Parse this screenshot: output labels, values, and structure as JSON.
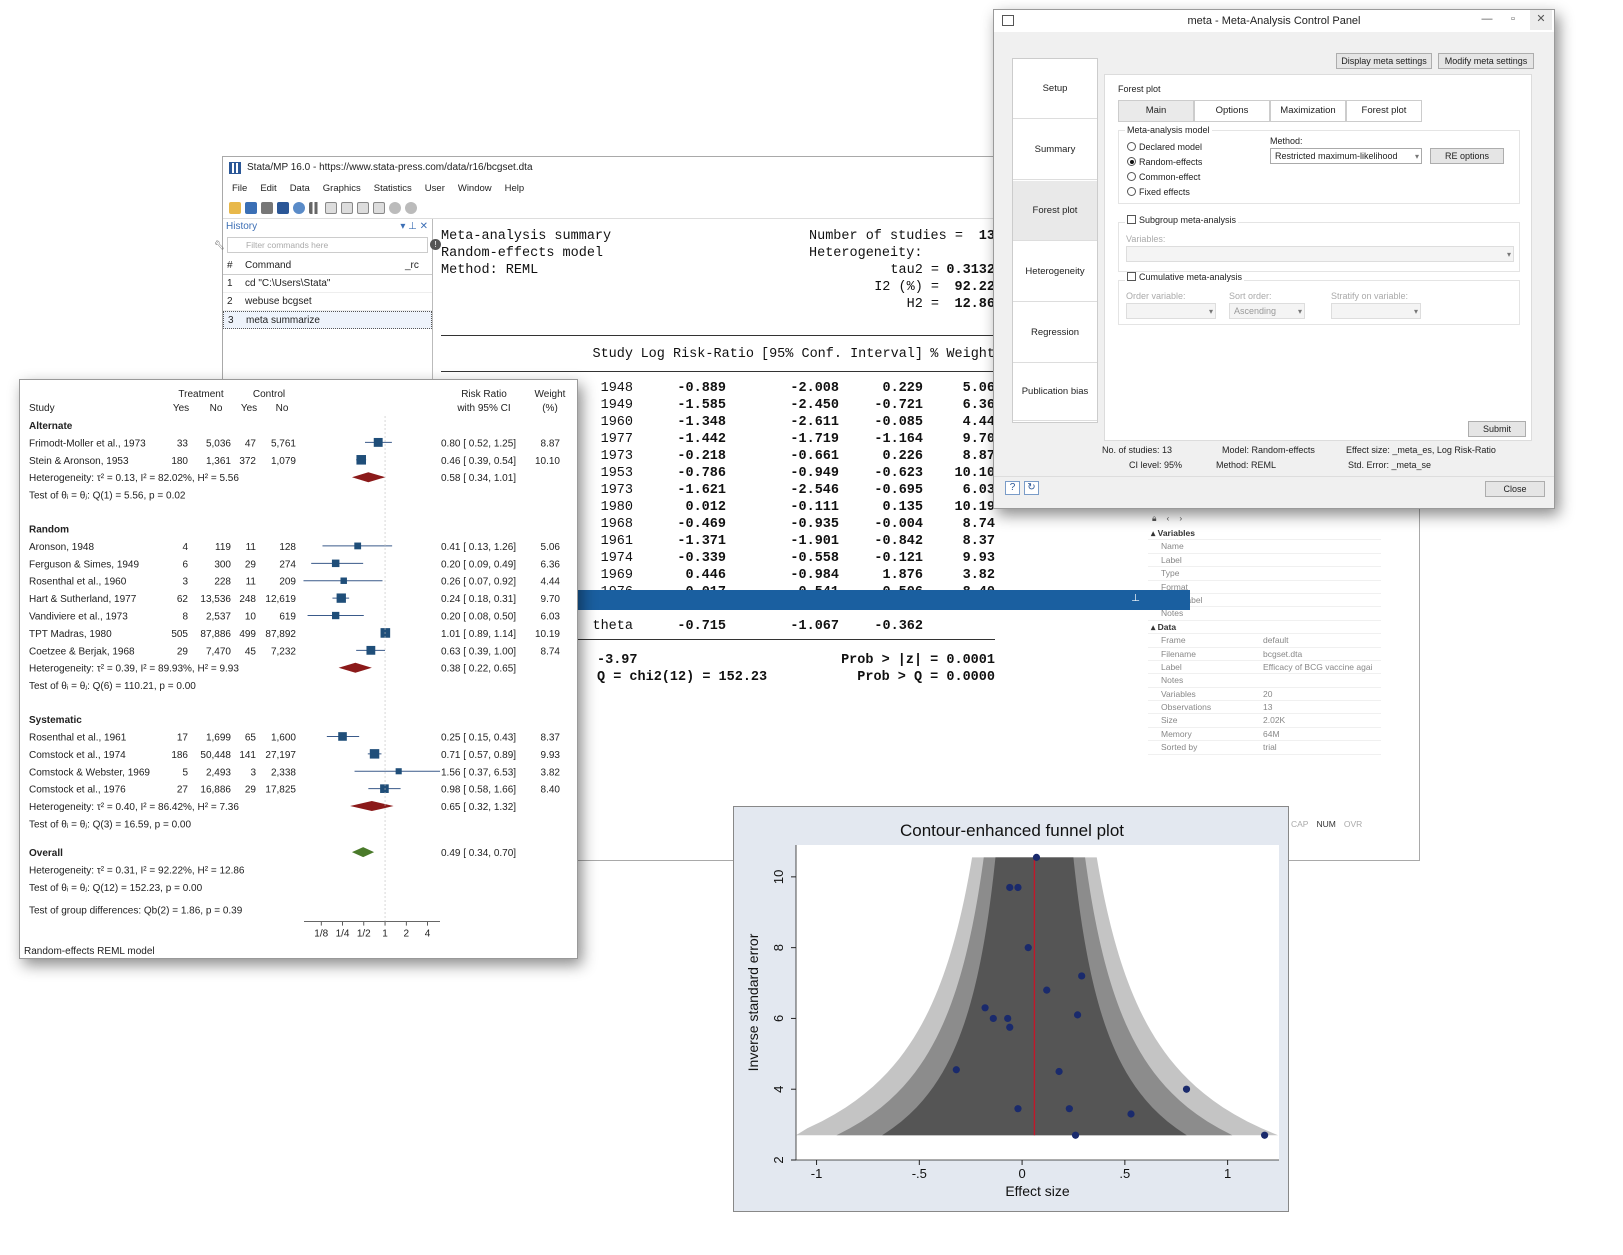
{
  "stata": {
    "title": "Stata/MP 16.0 - https://www.stata-press.com/data/r16/bcgset.dta",
    "menu": [
      "File",
      "Edit",
      "Data",
      "Graphics",
      "Statistics",
      "User",
      "Window",
      "Help"
    ],
    "history": {
      "title": "History",
      "filter_placeholder": "Filter commands here",
      "col_num": "#",
      "col_command": "Command",
      "col_rc": "_rc",
      "rows": [
        {
          "n": "1",
          "cmd": "cd \"C:\\Users\\Stata\""
        },
        {
          "n": "2",
          "cmd": "webuse bcgset"
        },
        {
          "n": "3",
          "cmd": "meta summarize"
        }
      ]
    },
    "results": {
      "l1": "Meta-analysis summary",
      "l2": "Random-effects model",
      "l3": "Method: REML",
      "n_label": "Number of studies =",
      "n_value": "13",
      "het_label": "Heterogeneity:",
      "tau2_label": "tau2 =",
      "tau2": "0.3132",
      "i2_label": "I2 (%) =",
      "i2": "92.22",
      "h2_label": "H2 =",
      "h2": "12.86",
      "headers": [
        "Study",
        "Log Risk-Ratio",
        "[95% Conf. Interval]",
        "% Weight"
      ],
      "rows": [
        {
          "year": "1948",
          "lrr": "-0.889",
          "lo": "-2.008",
          "hi": "0.229",
          "w": "5.06"
        },
        {
          "year": "1949",
          "lrr": "-1.585",
          "lo": "-2.450",
          "hi": "-0.721",
          "w": "6.36"
        },
        {
          "year": "1960",
          "lrr": "-1.348",
          "lo": "-2.611",
          "hi": "-0.085",
          "w": "4.44"
        },
        {
          "year": "1977",
          "lrr": "-1.442",
          "lo": "-1.719",
          "hi": "-1.164",
          "w": "9.70"
        },
        {
          "year": "1973",
          "lrr": "-0.218",
          "lo": "-0.661",
          "hi": "0.226",
          "w": "8.87"
        },
        {
          "year": "1953",
          "lrr": "-0.786",
          "lo": "-0.949",
          "hi": "-0.623",
          "w": "10.10"
        },
        {
          "year": "1973",
          "lrr": "-1.621",
          "lo": "-2.546",
          "hi": "-0.695",
          "w": "6.03"
        },
        {
          "year": "1980",
          "lrr": "0.012",
          "lo": "-0.111",
          "hi": "0.135",
          "w": "10.19"
        },
        {
          "year": "1968",
          "lrr": "-0.469",
          "lo": "-0.935",
          "hi": "-0.004",
          "w": "8.74"
        },
        {
          "year": "1961",
          "lrr": "-1.371",
          "lo": "-1.901",
          "hi": "-0.842",
          "w": "8.37"
        },
        {
          "year": "1974",
          "lrr": "-0.339",
          "lo": "-0.558",
          "hi": "-0.121",
          "w": "9.93"
        },
        {
          "year": "1969",
          "lrr": "0.446",
          "lo": "-0.984",
          "hi": "1.876",
          "w": "3.82"
        },
        {
          "year": "1976",
          "lrr": "-0.017",
          "lo": "-0.541",
          "hi": "0.506",
          "w": "8.40"
        }
      ],
      "theta_label": "theta",
      "theta": "-0.715",
      "theta_lo": "-1.067",
      "theta_hi": "-0.362",
      "z_text": "-3.97",
      "q_text": "Q = chi2(12) = 152.23",
      "p_z": "Prob > |z| = 0.0001",
      "p_q": "Prob > Q = 0.0000"
    },
    "properties": {
      "variables_section": "Variables",
      "var_keys": [
        "Name",
        "Label",
        "Type",
        "Format",
        "Value label",
        "Notes"
      ],
      "data_section": "Data",
      "data_rows": [
        {
          "k": "Frame",
          "v": "default"
        },
        {
          "k": "Filename",
          "v": "bcgset.dta"
        },
        {
          "k": "Label",
          "v": "Efficacy of BCG vaccine agai"
        },
        {
          "k": "Notes",
          "v": ""
        },
        {
          "k": "Variables",
          "v": "20"
        },
        {
          "k": "Observations",
          "v": "13"
        },
        {
          "k": "Size",
          "v": "2.02K"
        },
        {
          "k": "Memory",
          "v": "64M"
        },
        {
          "k": "Sorted by",
          "v": "trial"
        }
      ]
    },
    "status": [
      "CAP",
      "NUM",
      "OVR"
    ]
  },
  "forest": {
    "h_study": "Study",
    "h_treatment": "Treatment",
    "h_control": "Control",
    "h_yes": "Yes",
    "h_no": "No",
    "h_rr": "Risk Ratio",
    "h_ci": "with 95% CI",
    "h_weight": "Weight",
    "h_pct": "(%)",
    "groups": [
      {
        "name": "Alternate",
        "studies": [
          {
            "s": "Frimodt-Moller et al., 1973",
            "ty": "33",
            "tn": "5,036",
            "cy": "47",
            "cn": "5,761",
            "ci": "0.80 [  0.52,  1.25]",
            "w": "8.87",
            "rr": 0.8,
            "lo": 0.52,
            "hi": 1.25,
            "wt": 8.87
          },
          {
            "s": "Stein & Aronson, 1953",
            "ty": "180",
            "tn": "1,361",
            "cy": "372",
            "cn": "1,079",
            "ci": "0.46 [  0.39,  0.54]",
            "w": "10.10",
            "rr": 0.46,
            "lo": 0.39,
            "hi": 0.54,
            "wt": 10.1
          }
        ],
        "het": "Heterogeneity: τ² = 0.13, I² = 82.02%, H² = 5.56",
        "pooled": "0.58 [  0.34,  1.01]",
        "prr": 0.58,
        "plo": 0.34,
        "phi": 1.01,
        "test": "Test of θᵢ = θⱼ: Q(1) = 5.56, p = 0.02"
      },
      {
        "name": "Random",
        "studies": [
          {
            "s": "Aronson, 1948",
            "ty": "4",
            "tn": "119",
            "cy": "11",
            "cn": "128",
            "ci": "0.41 [  0.13,  1.26]",
            "w": "5.06",
            "rr": 0.41,
            "lo": 0.13,
            "hi": 1.26,
            "wt": 5.06
          },
          {
            "s": "Ferguson & Simes, 1949",
            "ty": "6",
            "tn": "300",
            "cy": "29",
            "cn": "274",
            "ci": "0.20 [  0.09,  0.49]",
            "w": "6.36",
            "rr": 0.2,
            "lo": 0.09,
            "hi": 0.49,
            "wt": 6.36
          },
          {
            "s": "Rosenthal et al., 1960",
            "ty": "3",
            "tn": "228",
            "cy": "11",
            "cn": "209",
            "ci": "0.26 [  0.07,  0.92]",
            "w": "4.44",
            "rr": 0.26,
            "lo": 0.07,
            "hi": 0.92,
            "wt": 4.44
          },
          {
            "s": "Hart & Sutherland, 1977",
            "ty": "62",
            "tn": "13,536",
            "cy": "248",
            "cn": "12,619",
            "ci": "0.24 [  0.18,  0.31]",
            "w": "9.70",
            "rr": 0.24,
            "lo": 0.18,
            "hi": 0.31,
            "wt": 9.7
          },
          {
            "s": "Vandiviere et al., 1973",
            "ty": "8",
            "tn": "2,537",
            "cy": "10",
            "cn": "619",
            "ci": "0.20 [  0.08,  0.50]",
            "w": "6.03",
            "rr": 0.2,
            "lo": 0.08,
            "hi": 0.5,
            "wt": 6.03
          },
          {
            "s": "TPT Madras, 1980",
            "ty": "505",
            "tn": "87,886",
            "cy": "499",
            "cn": "87,892",
            "ci": "1.01 [  0.89,  1.14]",
            "w": "10.19",
            "rr": 1.01,
            "lo": 0.89,
            "hi": 1.14,
            "wt": 10.19
          },
          {
            "s": "Coetzee & Berjak, 1968",
            "ty": "29",
            "tn": "7,470",
            "cy": "45",
            "cn": "7,232",
            "ci": "0.63 [  0.39,  1.00]",
            "w": "8.74",
            "rr": 0.63,
            "lo": 0.39,
            "hi": 1.0,
            "wt": 8.74
          }
        ],
        "het": "Heterogeneity: τ² = 0.39, I² = 89.93%, H² = 9.93",
        "pooled": "0.38 [  0.22,  0.65]",
        "prr": 0.38,
        "plo": 0.22,
        "phi": 0.65,
        "test": "Test of θᵢ = θⱼ: Q(6) = 110.21, p = 0.00"
      },
      {
        "name": "Systematic",
        "studies": [
          {
            "s": "Rosenthal et al., 1961",
            "ty": "17",
            "tn": "1,699",
            "cy": "65",
            "cn": "1,600",
            "ci": "0.25 [  0.15,  0.43]",
            "w": "8.37",
            "rr": 0.25,
            "lo": 0.15,
            "hi": 0.43,
            "wt": 8.37
          },
          {
            "s": "Comstock et al., 1974",
            "ty": "186",
            "tn": "50,448",
            "cy": "141",
            "cn": "27,197",
            "ci": "0.71 [  0.57,  0.89]",
            "w": "9.93",
            "rr": 0.71,
            "lo": 0.57,
            "hi": 0.89,
            "wt": 9.93
          },
          {
            "s": "Comstock & Webster, 1969",
            "ty": "5",
            "tn": "2,493",
            "cy": "3",
            "cn": "2,338",
            "ci": "1.56 [  0.37,  6.53]",
            "w": "3.82",
            "rr": 1.56,
            "lo": 0.37,
            "hi": 6.53,
            "wt": 3.82
          },
          {
            "s": "Comstock et al., 1976",
            "ty": "27",
            "tn": "16,886",
            "cy": "29",
            "cn": "17,825",
            "ci": "0.98 [  0.58,  1.66]",
            "w": "8.40",
            "rr": 0.98,
            "lo": 0.58,
            "hi": 1.66,
            "wt": 8.4
          }
        ],
        "het": "Heterogeneity: τ² = 0.40, I² = 86.42%, H² = 7.36",
        "pooled": "0.65 [  0.32,  1.32]",
        "prr": 0.65,
        "plo": 0.32,
        "phi": 1.32,
        "test": "Test of θᵢ = θⱼ: Q(3) = 16.59, p = 0.00"
      }
    ],
    "overall_label": "Overall",
    "overall_ci": "0.49 [  0.34,  0.70]",
    "orr": 0.49,
    "olo": 0.34,
    "ohi": 0.7,
    "overall_het": "Heterogeneity: τ² = 0.31, I² = 92.22%, H² = 12.86",
    "overall_test": "Test of θᵢ = θⱼ: Q(12) = 152.23, p = 0.00",
    "group_test": "Test of group differences: Qb(2) = 1.86, p = 0.39",
    "axis_ticks": [
      "1/8",
      "1/4",
      "1/2",
      "1",
      "2",
      "4"
    ],
    "footer": "Random-effects REML model",
    "colors": {
      "box": "#1f4e79",
      "diamond_sub": "#8b1a1a",
      "diamond_overall": "#4a7a2a"
    }
  },
  "panel": {
    "title": "meta - Meta-Analysis Control Panel",
    "display_btn": "Display meta settings",
    "modify_btn": "Modify meta settings",
    "nav": [
      "Setup",
      "Summary",
      "Forest plot",
      "Heterogeneity",
      "Regression",
      "Publication bias"
    ],
    "active_nav": "Forest plot",
    "group_title": "Forest plot",
    "tabs": [
      "Main",
      "Options",
      "Maximization",
      "Forest plot"
    ],
    "model_title": "Meta-analysis model",
    "models": [
      "Declared model",
      "Random-effects",
      "Common-effect",
      "Fixed effects"
    ],
    "method_label": "Method:",
    "method_value": "Restricted maximum-likelihood",
    "re_options": "RE options",
    "subgroup": "Subgroup meta-analysis",
    "variables_label": "Variables:",
    "cumulative": "Cumulative meta-analysis",
    "order_var": "Order variable:",
    "sort_order": "Sort order:",
    "sort_value": "Ascending",
    "stratify": "Stratify on variable:",
    "submit": "Submit",
    "info": {
      "n": "No. of studies: 13",
      "model": "Model: Random-effects",
      "es": "Effect size: _meta_es, Log Risk-Ratio",
      "ci": "CI level: 95%",
      "method": "Method: REML",
      "se": "Std. Error: _meta_se"
    },
    "close": "Close"
  },
  "funnel": {
    "title": "Contour-enhanced funnel plot",
    "chart_data": {
      "type": "scatter",
      "title": "Contour-enhanced funnel plot",
      "xlabel": "Effect size",
      "ylabel": "Inverse standard error",
      "xlim": [
        -1.1,
        1.25
      ],
      "ylim": [
        2.0,
        10.9
      ],
      "x_ticks": [
        "-1",
        "-.5",
        "0",
        ".5",
        "1"
      ],
      "y_ticks": [
        "2",
        "4",
        "6",
        "8",
        "10"
      ],
      "x_tick_values": [
        -1,
        -0.5,
        0,
        0.5,
        1
      ],
      "y_tick_values": [
        2,
        4,
        6,
        8,
        10
      ],
      "reference_line_x": 0.06,
      "points": [
        {
          "x": 0.07,
          "y": 10.55
        },
        {
          "x": -0.06,
          "y": 9.7
        },
        {
          "x": -0.02,
          "y": 9.7
        },
        {
          "x": 0.03,
          "y": 8.0
        },
        {
          "x": 0.29,
          "y": 7.2
        },
        {
          "x": 0.12,
          "y": 6.8
        },
        {
          "x": -0.18,
          "y": 6.3
        },
        {
          "x": 0.27,
          "y": 6.1
        },
        {
          "x": -0.14,
          "y": 6.0
        },
        {
          "x": -0.07,
          "y": 6.0
        },
        {
          "x": -0.06,
          "y": 5.75
        },
        {
          "x": -0.32,
          "y": 4.55
        },
        {
          "x": 0.18,
          "y": 4.5
        },
        {
          "x": 0.8,
          "y": 4.0
        },
        {
          "x": -0.02,
          "y": 3.45
        },
        {
          "x": 0.23,
          "y": 3.45
        },
        {
          "x": 0.53,
          "y": 3.3
        },
        {
          "x": 0.26,
          "y": 2.7
        },
        {
          "x": 1.18,
          "y": 2.7
        }
      ],
      "colors": {
        "point": "#1a2a6c",
        "line": "#c0182a",
        "inner": "#555555",
        "mid": "#8c8c8c",
        "outer": "#c4c4c4",
        "bg": "#e3e8f0"
      }
    }
  }
}
